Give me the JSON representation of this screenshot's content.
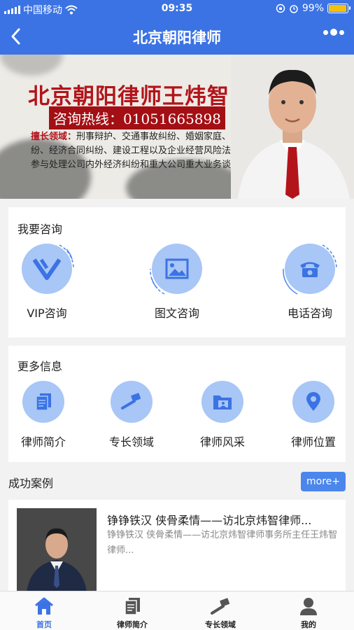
{
  "status_bar": {
    "carrier": "中国移动",
    "time": "09:35",
    "battery": "99%"
  },
  "nav": {
    "title": "北京朝阳律师"
  },
  "banner": {
    "title": "北京朝阳律师王炜智",
    "hotline": "咨询热线：01051665898",
    "specialty_label": "擅长领域：",
    "specialty_text": "刑事辩护、交通事故纠纷、婚姻家庭、房地产纠纷、经济合同纠纷、建设工程以及企业经营风险法律防控、参与处理公司内外经济纠纷和重大公司重大业务谈判等"
  },
  "consult": {
    "title": "我要咨询",
    "items": [
      {
        "label": "VIP咨询",
        "icon": "vip-icon"
      },
      {
        "label": "图文咨询",
        "icon": "image-icon"
      },
      {
        "label": "电话咨询",
        "icon": "phone-icon"
      }
    ]
  },
  "more_info": {
    "title": "更多信息",
    "items": [
      {
        "label": "律师简介",
        "icon": "document-icon"
      },
      {
        "label": "专长领域",
        "icon": "gavel-icon"
      },
      {
        "label": "律师风采",
        "icon": "folder-icon"
      },
      {
        "label": "律师位置",
        "icon": "location-icon"
      }
    ]
  },
  "cases": {
    "title": "成功案例",
    "more_label": "more+",
    "items": [
      {
        "title": "铮铮铁汉 侠骨柔情——访北京炜智律师...",
        "summary": "铮铮铁汉 侠骨柔情——访北京炜智律师事务所主任王炜智律师..."
      }
    ]
  },
  "tab_bar": {
    "items": [
      {
        "label": "首页",
        "icon": "home-icon",
        "active": true
      },
      {
        "label": "律师简介",
        "icon": "document-icon",
        "active": false
      },
      {
        "label": "专长领域",
        "icon": "gavel-icon",
        "active": false
      },
      {
        "label": "我的",
        "icon": "person-icon",
        "active": false
      }
    ]
  },
  "colors": {
    "primary": "#3b73e4",
    "icon_circle": "#a8c6f6",
    "icon_fill": "#3b73e4",
    "banner_red": "#b3141a"
  }
}
